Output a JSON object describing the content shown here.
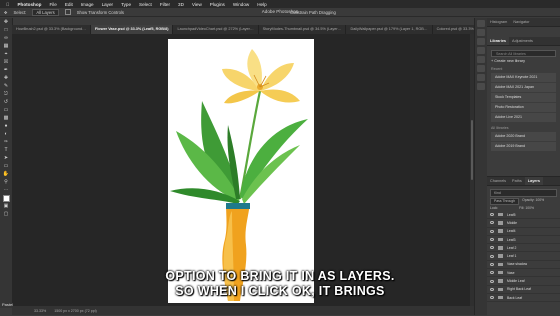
{
  "menubar": {
    "apple": "",
    "app": "Photoshop",
    "items": [
      "File",
      "Edit",
      "Image",
      "Layer",
      "Type",
      "Select",
      "Filter",
      "3D",
      "View",
      "Plugins",
      "Window",
      "Help"
    ]
  },
  "window_title": "Adobe Photoshop",
  "options": {
    "select_label": "Select:",
    "select_value": "All Layers",
    "show_transform": "Show Transform Controls",
    "constrain": "Constrain Path Dragging"
  },
  "doc_tabs": [
    {
      "label": "HowBrush2.psd @ 33.3% (Background…"
    },
    {
      "label": "Flower Vase.psd @ 33.3% (Leaf5, RGB/8)",
      "active": true
    },
    {
      "label": "LaunchpadVideoChart.psd @ 272% (Layer…"
    },
    {
      "label": "StoryModes-Thumbnail.psd @ 34.5% (Layer…"
    },
    {
      "label": "DailyWallpaper.psd @ 179% (Layer 1, RGB…"
    },
    {
      "label": "Colored.psd @ 33.3% (RGB/8)"
    }
  ],
  "status": {
    "zoom": "33.33%",
    "size": "1500 px x 2700 px (72 ppi)"
  },
  "panel": {
    "tabs": [
      "Histogram",
      "Navigator"
    ],
    "lib_tab": "Libraries",
    "lib_tab2": "Adjustments",
    "search_placeholder": "Search All libraries",
    "create": "+ Create new library",
    "recent_label": "Recent",
    "recent": [
      "Adobe MAX Keynote 2021",
      "Adobe MAX 2021 Japan",
      "Stock Templates",
      "Photo Restoration",
      "Adobe Live 2021"
    ],
    "all_label": "All libraries",
    "all": [
      "Adobe 2020 Brand",
      "Adobe 2019 Brand"
    ]
  },
  "layers_panel": {
    "tabs": [
      "Channels",
      "Paths",
      "Layers"
    ],
    "filter": "Kind",
    "blend": "Pass Through",
    "opacity": "Opacity: 100%",
    "lock": "Lock:",
    "fill": "Fill: 100%",
    "layers": [
      "Leaf5",
      "Middle",
      "Leaf4",
      "Leaf3",
      "Leaf 2",
      "Leaf 1",
      "Vase shadow",
      "Vase",
      "Middle Leaf",
      "Right Back Leaf",
      "Back Leaf"
    ]
  },
  "bottom_left": "Pastel",
  "subtitles": [
    "OPTION TO BRING IT IN AS LAYERS.",
    "SO WHEN I CLICK OK, IT BRINGS"
  ],
  "colors": {
    "accent": "#f2a71b",
    "vase": "#f0a21e",
    "leaf": "#4caf3f",
    "petal": "#f7d56b"
  }
}
